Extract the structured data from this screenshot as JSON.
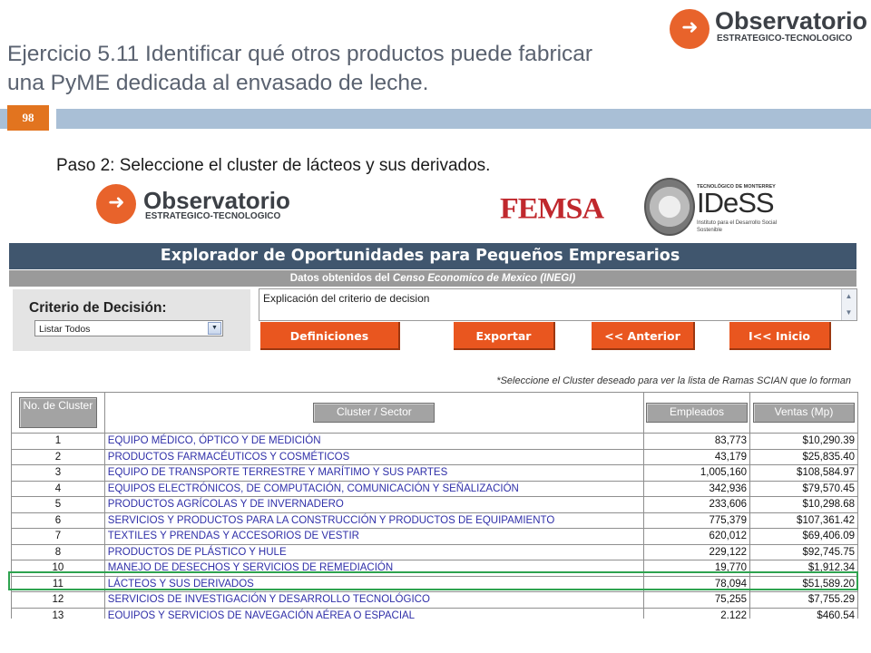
{
  "slide": {
    "title_line1": "Ejercicio 5.11 Identificar qué otros productos puede fabricar",
    "title_line2": "una PyME dedicada al envasado de leche.",
    "number": "98",
    "step_text": "Paso 2: Seleccione el cluster de lácteos y sus derivados."
  },
  "brand": {
    "name": "Observatorio",
    "subtitle": "ESTRATEGICO-TECNOLOGICO",
    "accent": "#e8632b"
  },
  "partners": {
    "femsa": "FEMSA",
    "idess_top": "TECNOLÓGICO DE MONTERREY",
    "idess": "IDeSS",
    "idess_sub": "Instituto para el Desarrollo Social Sostenible"
  },
  "app": {
    "header": "Explorador de Oportunidades para Pequeños Empresarios",
    "subheader_prefix": "Datos obtenidos del",
    "subheader_source": "Censo Economico de Mexico (INEGI)",
    "header_color": "#40566e",
    "button_color": "#e9561f"
  },
  "criteria": {
    "label": "Criterio de Decisión:",
    "selected": "Listar Todos"
  },
  "explanation": {
    "text": "Explicación del criterio de decision"
  },
  "buttons": {
    "definitions": "Definiciones",
    "export": "Exportar",
    "previous": "<< Anterior",
    "start": "I<< Inicio"
  },
  "instruction": "*Seleccione el Cluster deseado para ver la lista de Ramas SCIAN que lo forman",
  "table": {
    "headers": {
      "number": "No. de Cluster",
      "sector": "Cluster / Sector",
      "employees": "Empleados",
      "sales": "Ventas (Mp)"
    },
    "rows": [
      {
        "num": "1",
        "sector": "EQUIPO MÉDICO, ÓPTICO Y DE MEDICIÓN",
        "employees": "83,773",
        "sales": "$10,290.39"
      },
      {
        "num": "2",
        "sector": "PRODUCTOS FARMACÉUTICOS Y COSMÉTICOS",
        "employees": "43,179",
        "sales": "$25,835.40"
      },
      {
        "num": "3",
        "sector": "EQUIPO DE TRANSPORTE TERRESTRE Y MARÍTIMO Y SUS PARTES",
        "employees": "1,005,160",
        "sales": "$108,584.97"
      },
      {
        "num": "4",
        "sector": "EQUIPOS ELECTRÓNICOS, DE COMPUTACIÓN, COMUNICACIÓN Y SEÑALIZACIÓN",
        "employees": "342,936",
        "sales": "$79,570.45"
      },
      {
        "num": "5",
        "sector": "PRODUCTOS AGRÍCOLAS Y DE INVERNADERO",
        "employees": "233,606",
        "sales": "$10,298.68"
      },
      {
        "num": "6",
        "sector": "SERVICIOS Y PRODUCTOS PARA LA CONSTRUCCIÓN Y PRODUCTOS DE EQUIPAMIENTO",
        "employees": "775,379",
        "sales": "$107,361.42"
      },
      {
        "num": "7",
        "sector": "TEXTILES Y PRENDAS Y ACCESORIOS DE VESTIR",
        "employees": "620,012",
        "sales": "$69,406.09"
      },
      {
        "num": "8",
        "sector": "PRODUCTOS DE PLÁSTICO Y HULE",
        "employees": "229,122",
        "sales": "$92,745.75"
      },
      {
        "num": "10",
        "sector": "MANEJO DE DESECHOS Y SERVICIOS DE REMEDIACIÓN",
        "employees": "19,770",
        "sales": "$1,912.34"
      },
      {
        "num": "11",
        "sector": "LÁCTEOS Y SUS DERIVADOS",
        "employees": "78,094",
        "sales": "$51,589.20"
      },
      {
        "num": "12",
        "sector": "SERVICIOS DE INVESTIGACIÓN Y DESARROLLO TECNOLÓGICO",
        "employees": "75,255",
        "sales": "$7,755.29"
      },
      {
        "num": "13",
        "sector": "EQUIPOS Y SERVICIOS DE NAVEGACIÓN AÉREA O ESPACIAL",
        "employees": "2,122",
        "sales": "$460.54"
      }
    ],
    "highlight_color": "#2ea34f"
  }
}
